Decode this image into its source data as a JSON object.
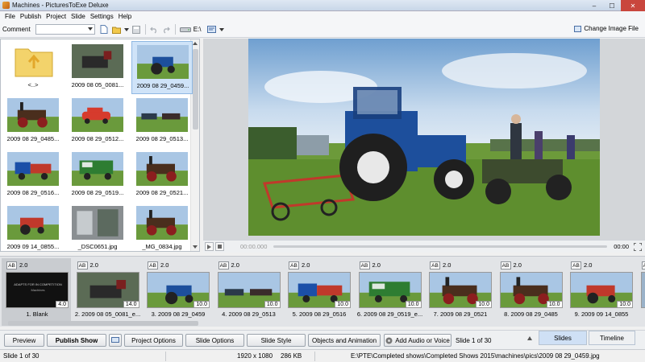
{
  "window": {
    "title": "Machines - PicturesToExe Deluxe",
    "min": "–",
    "max": "☐",
    "close": "✕"
  },
  "menu": [
    "File",
    "Publish",
    "Project",
    "Slide",
    "Settings",
    "Help"
  ],
  "toolbar": {
    "comment_label": "Comment",
    "drive_label": "E:\\",
    "change_image_label": "Change Image File"
  },
  "browser": {
    "items": [
      {
        "label": "<..>",
        "type": "folder"
      },
      {
        "label": "2009 08 05_0081...",
        "type": "image",
        "scene": "train"
      },
      {
        "label": "2009 08 29_0459...",
        "type": "image",
        "scene": "tractor",
        "selected": true
      },
      {
        "label": "2009 08 29_0485...",
        "type": "image",
        "scene": "engine"
      },
      {
        "label": "2009 08 29_0512...",
        "type": "image",
        "scene": "car"
      },
      {
        "label": "2009 08 29_0513...",
        "type": "image",
        "scene": "vintage"
      },
      {
        "label": "2009 08 29_0516...",
        "type": "image",
        "scene": "lorry"
      },
      {
        "label": "2009 08 29_0519...",
        "type": "image",
        "scene": "greenlorry"
      },
      {
        "label": "2009 08 29_0521...",
        "type": "image",
        "scene": "engine2"
      },
      {
        "label": "2009 09 14_0855...",
        "type": "image",
        "scene": "redtractor"
      },
      {
        "label": "_DSC0651.jpg",
        "type": "image",
        "scene": "shed"
      },
      {
        "label": "_MG_0834.jpg",
        "type": "image",
        "scene": "engine3"
      }
    ]
  },
  "player": {
    "time_start": "00:00.000",
    "time_end": "00:00"
  },
  "slides": [
    {
      "caption": "1. Blank",
      "duration": "2.0",
      "time": "4.0",
      "ab": "AB",
      "scene": "blank",
      "blank_line1": "ADAPTS FOR IN COMPETITION",
      "blank_line2": "Machines",
      "selected": true
    },
    {
      "caption": "2. 2009 08 05_0081_e...",
      "duration": "2.0",
      "time": "14.0",
      "ab": "AB",
      "scene": "train"
    },
    {
      "caption": "3. 2009 08 29_0459",
      "duration": "2.0",
      "time": "10.0",
      "ab": "AB",
      "scene": "tractor"
    },
    {
      "caption": "4. 2009 08 29_0513",
      "duration": "2.0",
      "time": "10.0",
      "ab": "AB",
      "scene": "vintage"
    },
    {
      "caption": "5. 2009 08 29_0516",
      "duration": "2.0",
      "time": "10.0",
      "ab": "AB",
      "scene": "lorry"
    },
    {
      "caption": "6. 2009 08 29_0519_e...",
      "duration": "2.0",
      "time": "10.0",
      "ab": "AB",
      "scene": "greenlorry"
    },
    {
      "caption": "7. 2009 08 29_0521",
      "duration": "2.0",
      "time": "10.0",
      "ab": "AB",
      "scene": "engine2"
    },
    {
      "caption": "8. 2009 08 29_0485",
      "duration": "2.0",
      "time": "10.0",
      "ab": "AB",
      "scene": "engine"
    },
    {
      "caption": "9. 2009 09 14_0855",
      "duration": "2.0",
      "time": "10.0",
      "ab": "AB",
      "scene": "redtractor"
    },
    {
      "caption": "",
      "duration": "",
      "time": "",
      "ab": "AB",
      "scene": "partial"
    }
  ],
  "buttons": {
    "preview": "Preview",
    "publish": "Publish Show",
    "project_options": "Project Options",
    "slide_options": "Slide Options",
    "slide_style": "Slide Style",
    "objects": "Objects and Animation",
    "audio": "Add Audio or Voice",
    "slide_counter": "Slide 1 of 30"
  },
  "tabs": {
    "slides": "Slides",
    "timeline": "Timeline"
  },
  "status": {
    "slide": "Slide 1 of 30",
    "resolution": "1920 x 1080",
    "size": "286 KB",
    "path": "E:\\PTE\\Completed shows\\Completed Shows 2015\\machines\\pics\\2009 08 29_0459.jpg"
  }
}
